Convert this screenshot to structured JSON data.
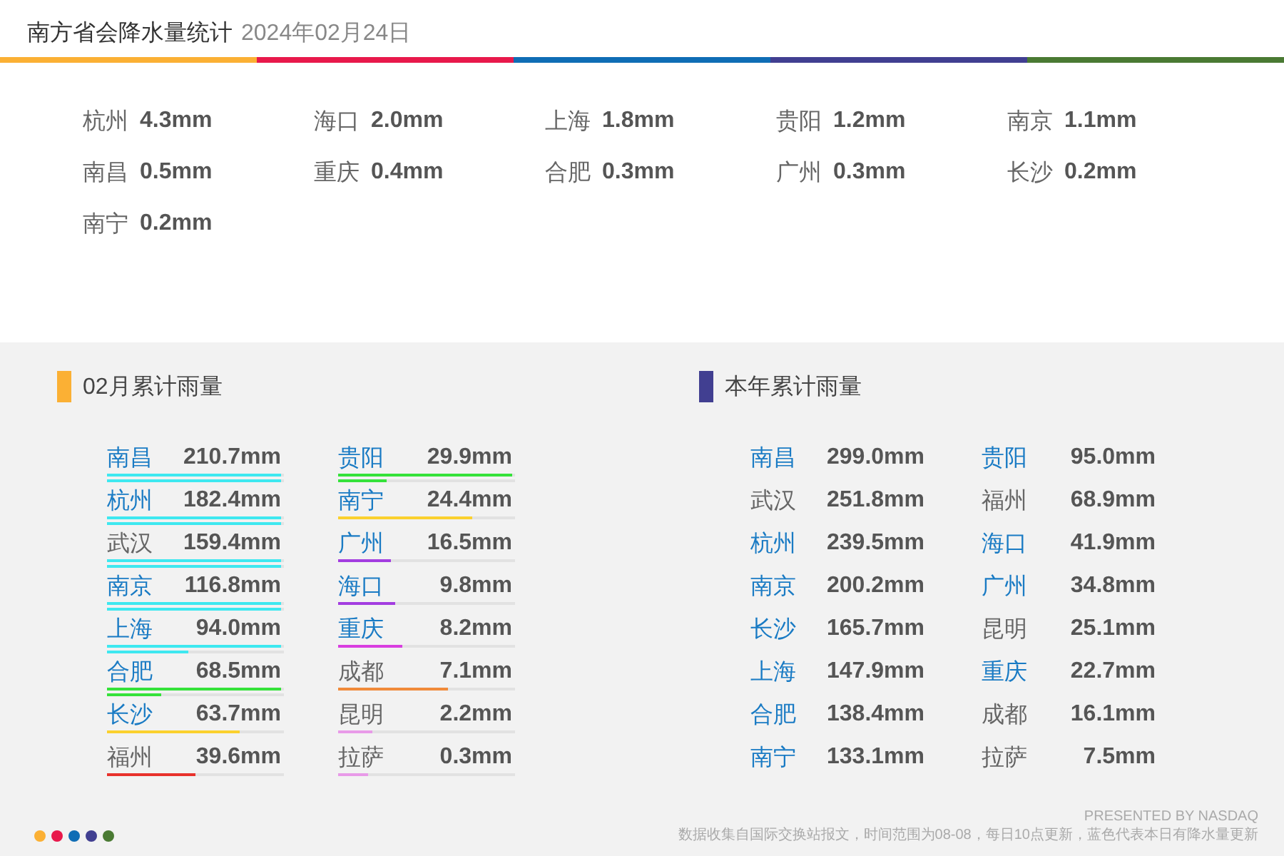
{
  "header": {
    "title": "南方省会降水量统计",
    "date": "2024年02月24日"
  },
  "daily": [
    {
      "city": "杭州",
      "amount": "4.3mm"
    },
    {
      "city": "海口",
      "amount": "2.0mm"
    },
    {
      "city": "上海",
      "amount": "1.8mm"
    },
    {
      "city": "贵阳",
      "amount": "1.2mm"
    },
    {
      "city": "南京",
      "amount": "1.1mm"
    },
    {
      "city": "南昌",
      "amount": "0.5mm"
    },
    {
      "city": "重庆",
      "amount": "0.4mm"
    },
    {
      "city": "合肥",
      "amount": "0.3mm"
    },
    {
      "city": "广州",
      "amount": "0.3mm"
    },
    {
      "city": "长沙",
      "amount": "0.2mm"
    },
    {
      "city": "南宁",
      "amount": "0.2mm"
    }
  ],
  "monthly": {
    "title": "02月累计雨量",
    "color": "#fbb034",
    "columns": [
      [
        {
          "city": "南昌",
          "amount": "210.7mm",
          "updated": true,
          "bars": [
            {
              "level": 1,
              "color": "#3ee8f0"
            },
            {
              "level": 1,
              "color": "#3ee8f0"
            }
          ]
        },
        {
          "city": "杭州",
          "amount": "182.4mm",
          "updated": true,
          "bars": [
            {
              "level": 1,
              "color": "#3ee8f0"
            },
            {
              "level": 1,
              "color": "#3ee8f0"
            }
          ]
        },
        {
          "city": "武汉",
          "amount": "159.4mm",
          "updated": false,
          "bars": [
            {
              "level": 1,
              "color": "#3ee8f0"
            },
            {
              "level": 1,
              "color": "#3ee8f0"
            }
          ]
        },
        {
          "city": "南京",
          "amount": "116.8mm",
          "updated": true,
          "bars": [
            {
              "level": 1,
              "color": "#3ee8f0"
            },
            {
              "level": 1,
              "color": "#3ee8f0"
            }
          ]
        },
        {
          "city": "上海",
          "amount": "94.0mm",
          "updated": true,
          "bars": [
            {
              "level": 1,
              "color": "#3ee8f0"
            },
            {
              "level": 0.47,
              "color": "#3ee8f0"
            }
          ]
        },
        {
          "city": "合肥",
          "amount": "68.5mm",
          "updated": true,
          "bars": [
            {
              "level": 1,
              "color": "#35e23a"
            },
            {
              "level": 0.31,
              "color": "#35e23a"
            }
          ]
        },
        {
          "city": "长沙",
          "amount": "63.7mm",
          "updated": true,
          "bars": [
            {
              "level": 0.76,
              "color": "#fbd12e"
            }
          ]
        },
        {
          "city": "福州",
          "amount": "39.6mm",
          "updated": false,
          "bars": [
            {
              "level": 0.51,
              "color": "#e8322c"
            }
          ]
        }
      ],
      [
        {
          "city": "贵阳",
          "amount": "29.9mm",
          "updated": true,
          "bars": [
            {
              "level": 1,
              "color": "#35e23a"
            },
            {
              "level": 0.28,
              "color": "#35e23a"
            }
          ]
        },
        {
          "city": "南宁",
          "amount": "24.4mm",
          "updated": true,
          "bars": [
            {
              "level": 0.77,
              "color": "#fbd12e"
            }
          ]
        },
        {
          "city": "广州",
          "amount": "16.5mm",
          "updated": true,
          "bars": [
            {
              "level": 0.3,
              "color": "#a33de0"
            }
          ]
        },
        {
          "city": "海口",
          "amount": "9.8mm",
          "updated": true,
          "bars": [
            {
              "level": 0.33,
              "color": "#a33de0"
            }
          ]
        },
        {
          "city": "重庆",
          "amount": "8.2mm",
          "updated": true,
          "bars": [
            {
              "level": 0.37,
              "color": "#d93ee0"
            }
          ]
        },
        {
          "city": "成都",
          "amount": "7.1mm",
          "updated": false,
          "bars": [
            {
              "level": 0.63,
              "color": "#f08a3a"
            }
          ]
        },
        {
          "city": "昆明",
          "amount": "2.2mm",
          "updated": false,
          "bars": [
            {
              "level": 0.2,
              "color": "#e89ae8"
            }
          ]
        },
        {
          "city": "拉萨",
          "amount": "0.3mm",
          "updated": false,
          "bars": [
            {
              "level": 0.17,
              "color": "#e89ae8"
            }
          ]
        }
      ]
    ]
  },
  "yearly": {
    "title": "本年累计雨量",
    "color": "#413f91",
    "columns": [
      [
        {
          "city": "南昌",
          "amount": "299.0mm",
          "updated": true
        },
        {
          "city": "武汉",
          "amount": "251.8mm",
          "updated": false
        },
        {
          "city": "杭州",
          "amount": "239.5mm",
          "updated": true
        },
        {
          "city": "南京",
          "amount": "200.2mm",
          "updated": true
        },
        {
          "city": "长沙",
          "amount": "165.7mm",
          "updated": true
        },
        {
          "city": "上海",
          "amount": "147.9mm",
          "updated": true
        },
        {
          "city": "合肥",
          "amount": "138.4mm",
          "updated": true
        },
        {
          "city": "南宁",
          "amount": "133.1mm",
          "updated": true
        }
      ],
      [
        {
          "city": "贵阳",
          "amount": "95.0mm",
          "updated": true
        },
        {
          "city": "福州",
          "amount": "68.9mm",
          "updated": false
        },
        {
          "city": "海口",
          "amount": "41.9mm",
          "updated": true
        },
        {
          "city": "广州",
          "amount": "34.8mm",
          "updated": true
        },
        {
          "city": "昆明",
          "amount": "25.1mm",
          "updated": false
        },
        {
          "city": "重庆",
          "amount": "22.7mm",
          "updated": true
        },
        {
          "city": "成都",
          "amount": "16.1mm",
          "updated": false
        },
        {
          "city": "拉萨",
          "amount": "7.5mm",
          "updated": false
        }
      ]
    ]
  },
  "footer": {
    "credit": "PRESENTED BY NASDAQ",
    "note": "数据收集自国际交换站报文，时间范围为08-08，每日10点更新，蓝色代表本日有降水量更新"
  }
}
